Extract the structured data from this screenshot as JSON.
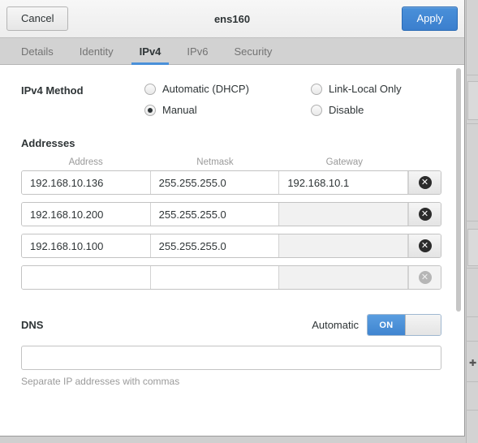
{
  "window": {
    "title": "ens160",
    "cancel_label": "Cancel",
    "apply_label": "Apply"
  },
  "tabs": [
    {
      "label": "Details",
      "active": false
    },
    {
      "label": "Identity",
      "active": false
    },
    {
      "label": "IPv4",
      "active": true
    },
    {
      "label": "IPv6",
      "active": false
    },
    {
      "label": "Security",
      "active": false
    }
  ],
  "ipv4_method": {
    "label": "IPv4 Method",
    "options": [
      {
        "label": "Automatic (DHCP)",
        "selected": false
      },
      {
        "label": "Link-Local Only",
        "selected": false
      },
      {
        "label": "Manual",
        "selected": true
      },
      {
        "label": "Disable",
        "selected": false
      }
    ]
  },
  "addresses": {
    "title": "Addresses",
    "columns": [
      "Address",
      "Netmask",
      "Gateway"
    ],
    "rows": [
      {
        "address": "192.168.10.136",
        "netmask": "255.255.255.0",
        "gateway": "192.168.10.1",
        "delete_enabled": true
      },
      {
        "address": "192.168.10.200",
        "netmask": "255.255.255.0",
        "gateway": "",
        "delete_enabled": true
      },
      {
        "address": "192.168.10.100",
        "netmask": "255.255.255.0",
        "gateway": "",
        "delete_enabled": true
      },
      {
        "address": "",
        "netmask": "",
        "gateway": "",
        "delete_enabled": false
      }
    ],
    "delete_glyph": "✕"
  },
  "dns": {
    "title": "DNS",
    "automatic_label": "Automatic",
    "toggle_state": "ON",
    "value": "",
    "placeholder": "",
    "hint": "Separate IP addresses with commas"
  },
  "colors": {
    "accent": "#4a90d9",
    "toggle_on": "#3f85d0",
    "tabbar": "#d2d2d2",
    "text": "#2e3436",
    "muted": "#9a9a9a"
  }
}
